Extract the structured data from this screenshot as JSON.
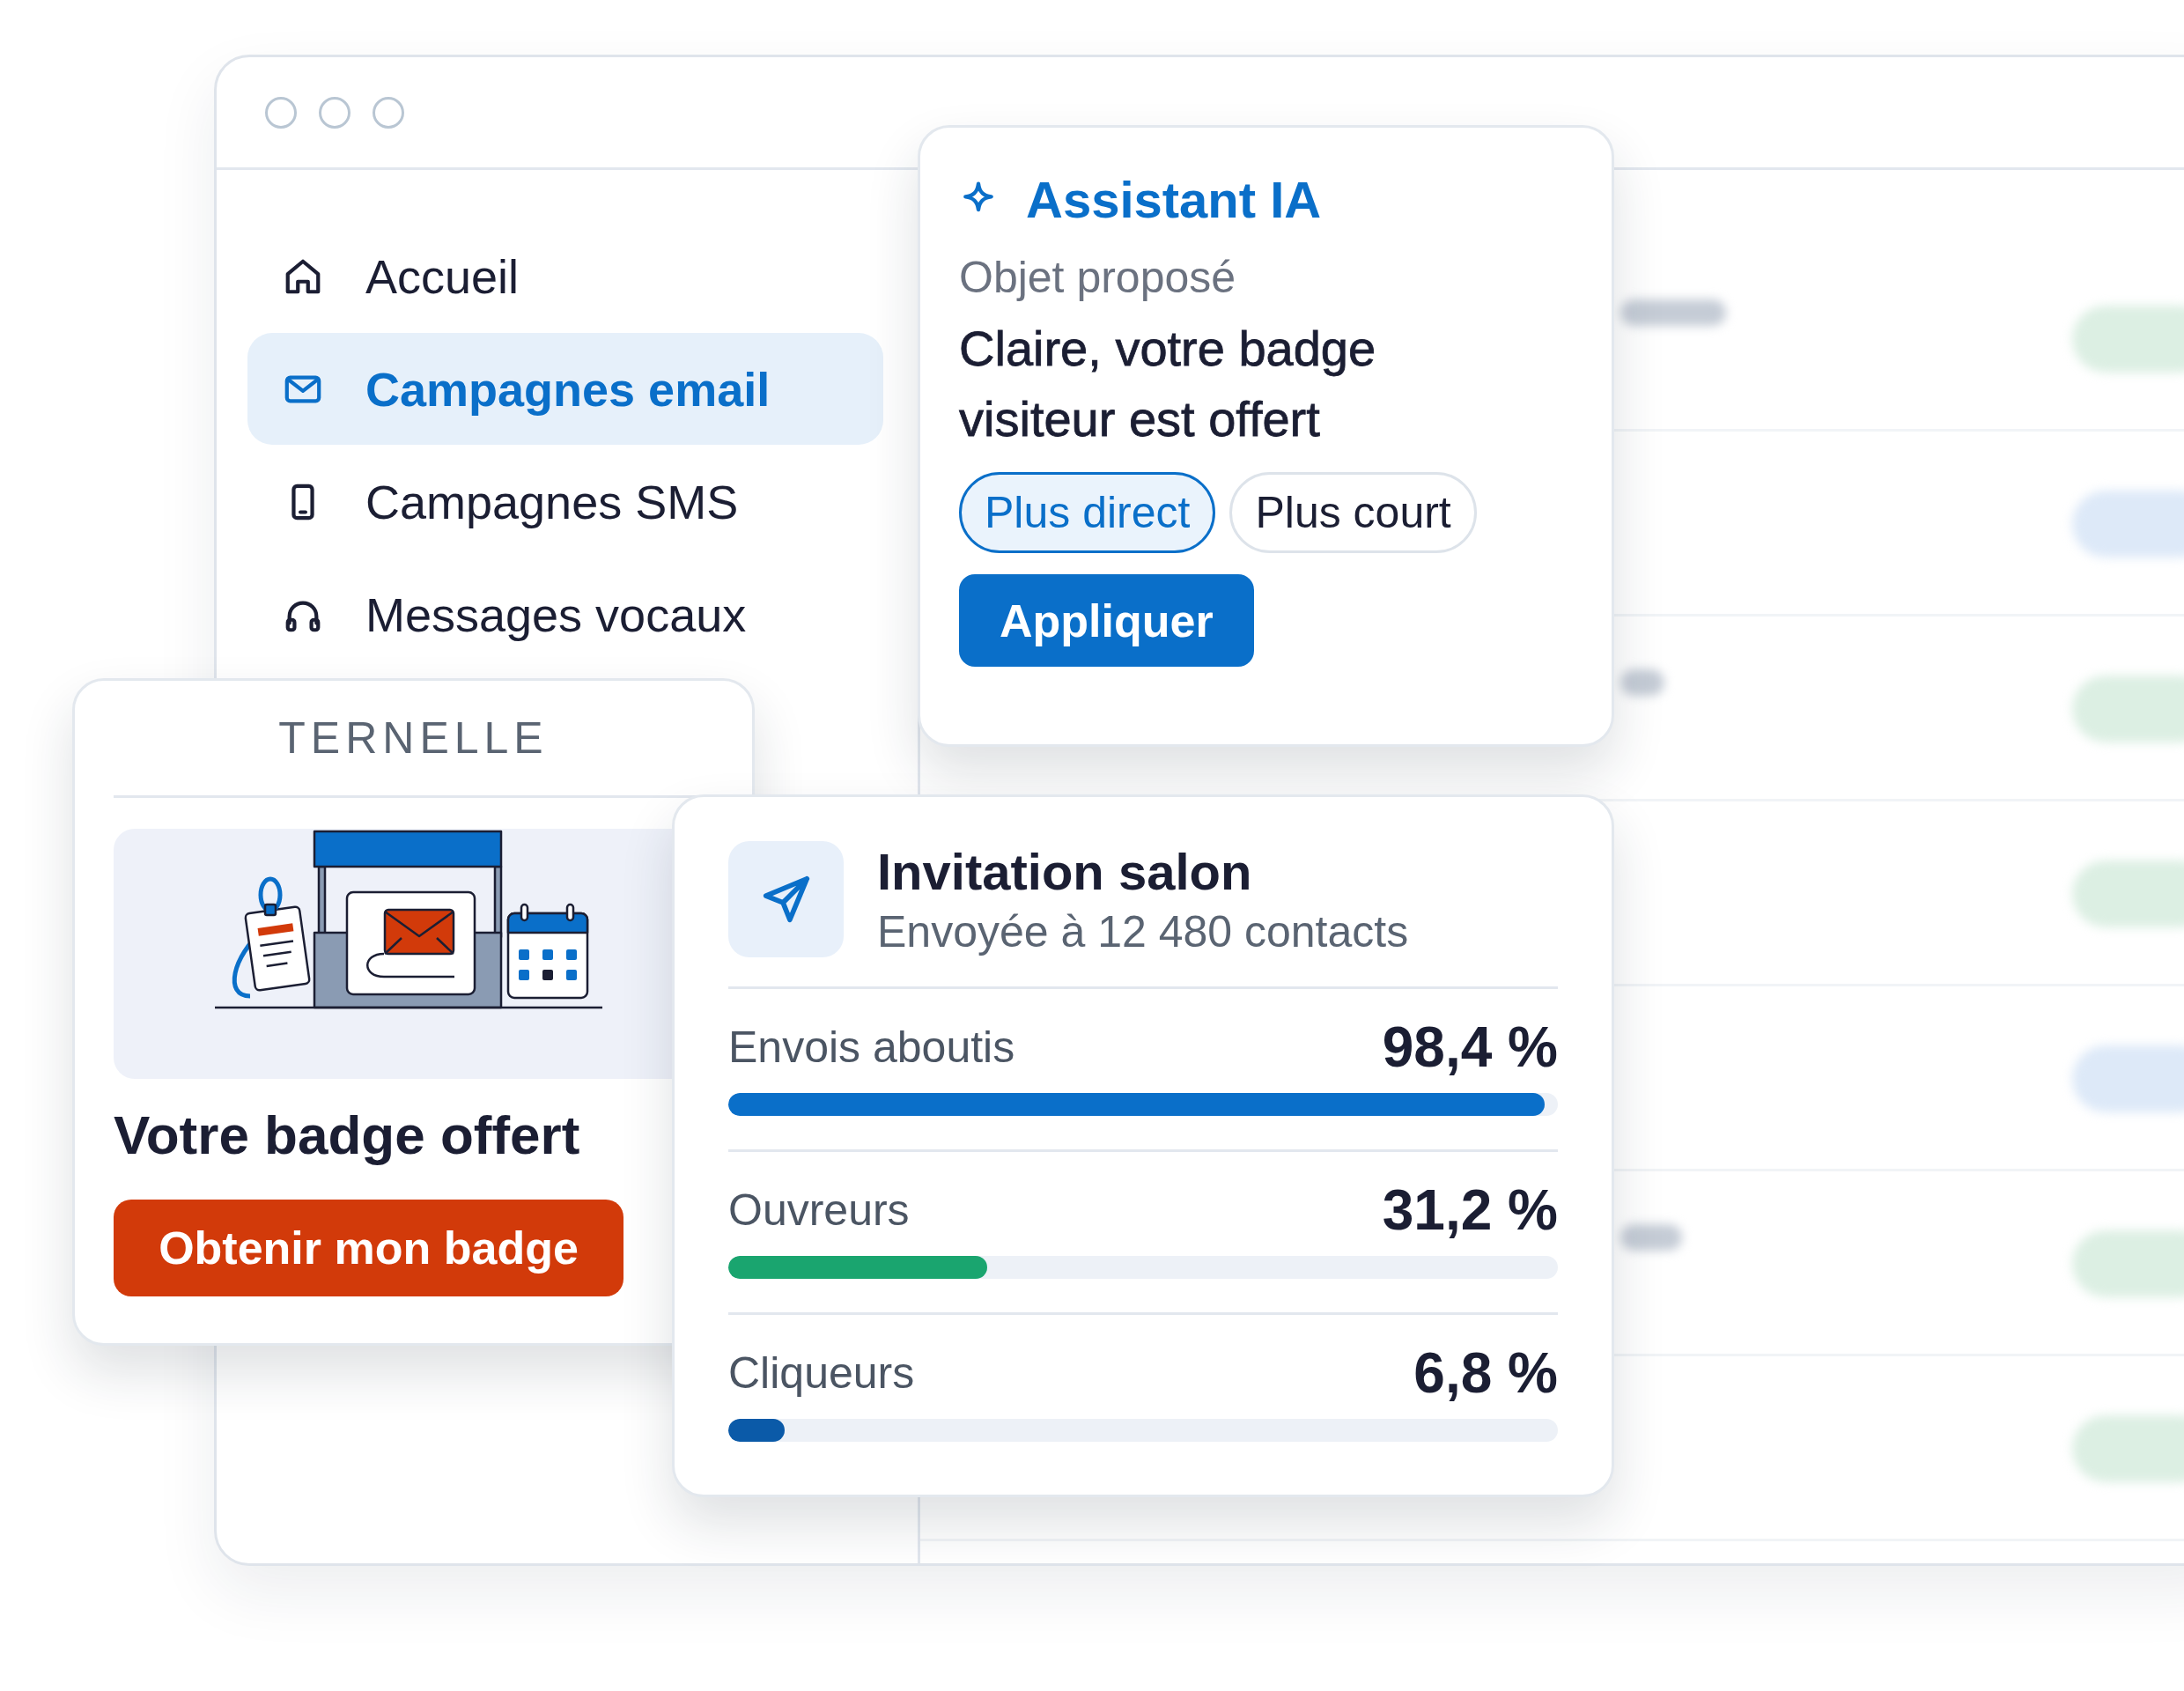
{
  "sidebar": {
    "items": [
      {
        "kind": "home",
        "label": "Accueil",
        "selected": false
      },
      {
        "kind": "mail",
        "label": "Campagnes email",
        "selected": true
      },
      {
        "kind": "phone",
        "label": "Campagnes SMS",
        "selected": false
      },
      {
        "kind": "headphones",
        "label": "Messages vocaux",
        "selected": false
      }
    ]
  },
  "ai_assistant": {
    "title": "Assistant IA",
    "label": "Objet proposé",
    "subject": "Claire, votre badge visiteur est offert",
    "chips": [
      {
        "label": "Plus direct",
        "selected": true
      },
      {
        "label": "Plus court",
        "selected": false
      }
    ],
    "button": "Appliquer"
  },
  "promo": {
    "brand": "TERNELLE",
    "title": "Votre badge offert",
    "button": "Obtenir mon badge"
  },
  "campaign": {
    "title": "Invitation salon",
    "subtitle": "Envoyée à 12 480 contacts",
    "metrics": [
      {
        "label": "Envois aboutis",
        "value": "98,4 %",
        "level": 0.984,
        "color": "#0a6fc9"
      },
      {
        "label": "Ouvreurs",
        "value": "31,2 %",
        "level": 0.312,
        "color": "#1aa56f"
      },
      {
        "label": "Cliqueurs",
        "value": "6,8 %",
        "level": 0.068,
        "color": "#0b5aa8"
      }
    ]
  }
}
